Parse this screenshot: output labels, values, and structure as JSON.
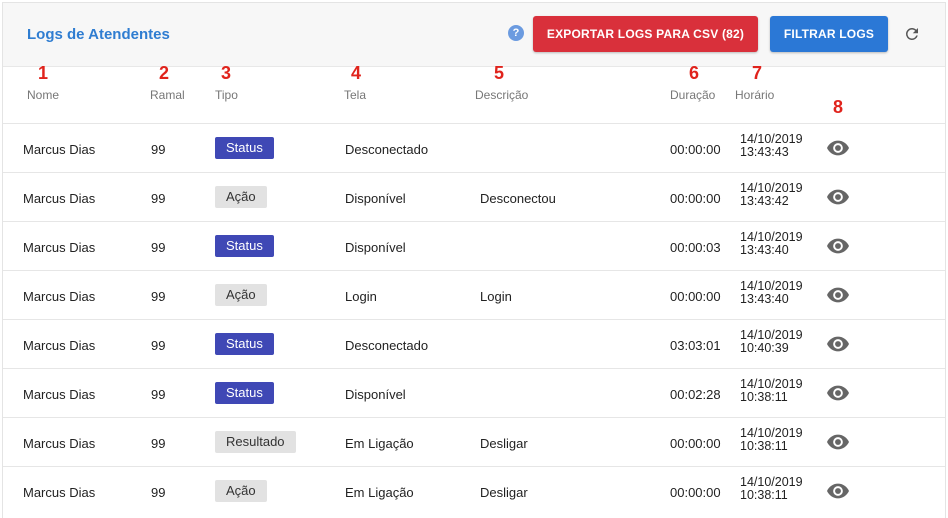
{
  "header": {
    "title": "Logs de Atendentes",
    "help_icon": "?",
    "export_label": "EXPORTAR LOGS PARA CSV (82)",
    "filter_label": "FILTRAR LOGS"
  },
  "annotations": [
    "1",
    "2",
    "3",
    "4",
    "5",
    "6",
    "7",
    "8"
  ],
  "columns": [
    "Nome",
    "Ramal",
    "Tipo",
    "Tela",
    "Descrição",
    "Duração",
    "Horário"
  ],
  "colors": {
    "title": "#2f7dd1",
    "export_button": "#d9303b",
    "filter_button": "#2b78d6",
    "status_badge": "#3f48b5",
    "annotation": "#e0231c"
  },
  "rows": [
    {
      "nome": "Marcus Dias",
      "ramal": "99",
      "tipo": "Status",
      "tela": "Desconectado",
      "descricao": "",
      "duracao": "00:00:00",
      "data": "14/10/2019",
      "hora": "13:43:43"
    },
    {
      "nome": "Marcus Dias",
      "ramal": "99",
      "tipo": "Ação",
      "tela": "Disponível",
      "descricao": "Desconectou",
      "duracao": "00:00:00",
      "data": "14/10/2019",
      "hora": "13:43:42"
    },
    {
      "nome": "Marcus Dias",
      "ramal": "99",
      "tipo": "Status",
      "tela": "Disponível",
      "descricao": "",
      "duracao": "00:00:03",
      "data": "14/10/2019",
      "hora": "13:43:40"
    },
    {
      "nome": "Marcus Dias",
      "ramal": "99",
      "tipo": "Ação",
      "tela": "Login",
      "descricao": "Login",
      "duracao": "00:00:00",
      "data": "14/10/2019",
      "hora": "13:43:40"
    },
    {
      "nome": "Marcus Dias",
      "ramal": "99",
      "tipo": "Status",
      "tela": "Desconectado",
      "descricao": "",
      "duracao": "03:03:01",
      "data": "14/10/2019",
      "hora": "10:40:39"
    },
    {
      "nome": "Marcus Dias",
      "ramal": "99",
      "tipo": "Status",
      "tela": "Disponível",
      "descricao": "",
      "duracao": "00:02:28",
      "data": "14/10/2019",
      "hora": "10:38:11"
    },
    {
      "nome": "Marcus Dias",
      "ramal": "99",
      "tipo": "Resultado",
      "tela": "Em Ligação",
      "descricao": "Desligar",
      "duracao": "00:00:00",
      "data": "14/10/2019",
      "hora": "10:38:11"
    },
    {
      "nome": "Marcus Dias",
      "ramal": "99",
      "tipo": "Ação",
      "tela": "Em Ligação",
      "descricao": "Desligar",
      "duracao": "00:00:00",
      "data": "14/10/2019",
      "hora": "10:38:11"
    }
  ]
}
